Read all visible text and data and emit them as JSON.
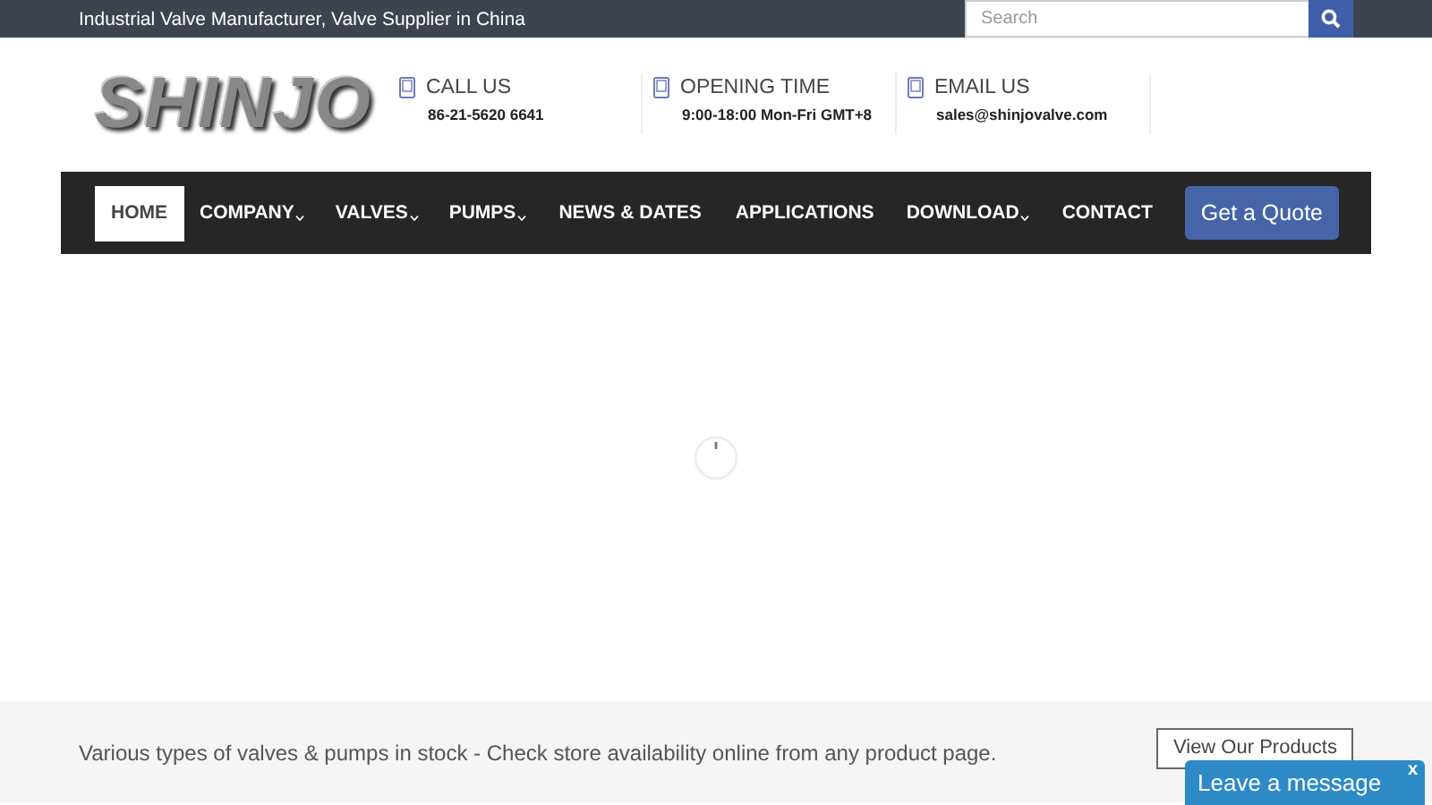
{
  "top_bar": {
    "tagline": "Industrial Valve Manufacturer, Valve Supplier in China",
    "search": {
      "placeholder": "Search"
    }
  },
  "header": {
    "logo": "SHINJO",
    "contacts": [
      {
        "label": "CALL US",
        "value": "86-21-5620 6641"
      },
      {
        "label": "OPENING TIME",
        "value": "9:00-18:00 Mon-Fri GMT+8"
      },
      {
        "label": "EMAIL US",
        "value": "sales@shinjovalve.com"
      }
    ]
  },
  "nav": {
    "items": [
      {
        "label": "HOME",
        "selected": true,
        "dropdown": false
      },
      {
        "label": "COMPANY",
        "selected": false,
        "dropdown": true
      },
      {
        "label": "VALVES",
        "selected": false,
        "dropdown": true
      },
      {
        "label": "PUMPS",
        "selected": false,
        "dropdown": true
      },
      {
        "label": "NEWS & DATES",
        "selected": false,
        "dropdown": false
      },
      {
        "label": "APPLICATIONS",
        "selected": false,
        "dropdown": false
      },
      {
        "label": "DOWNLOAD",
        "selected": false,
        "dropdown": true
      },
      {
        "label": "CONTACT",
        "selected": false,
        "dropdown": false
      }
    ],
    "quote_button": "Get a Quote"
  },
  "banner": {
    "text": "Various types of valves & pumps in stock - Check store availability online from any product page.",
    "button": "View Our Products"
  },
  "chat_widget": {
    "label": "Leave a message",
    "close": "x"
  }
}
